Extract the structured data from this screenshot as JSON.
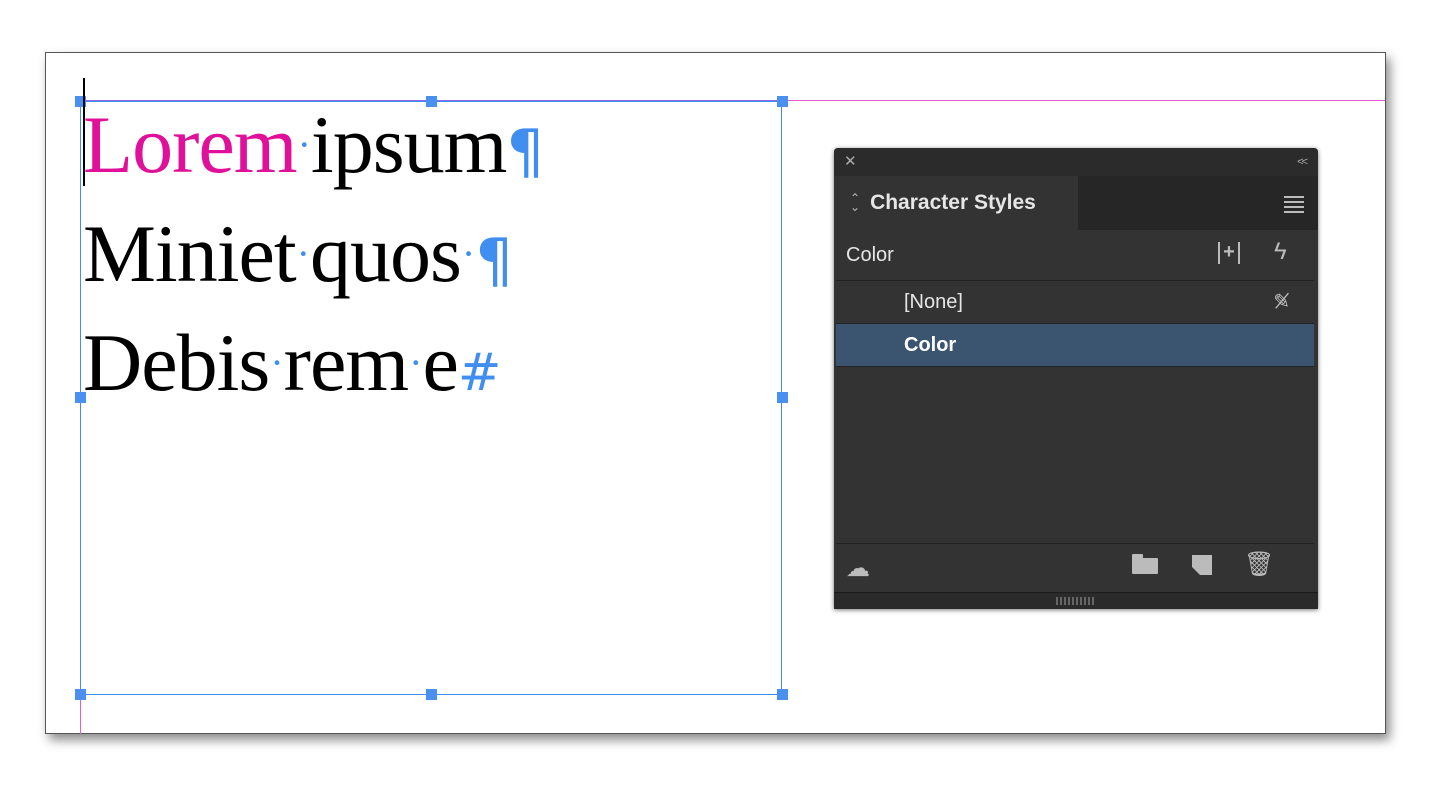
{
  "document": {
    "lines": [
      {
        "words": [
          "Lorem",
          "ipsum"
        ],
        "end_mark": "¶"
      },
      {
        "words": [
          "Miniet",
          "quos"
        ],
        "end_mark": "¶"
      },
      {
        "words": [
          "Debis",
          "rem",
          "e"
        ],
        "end_mark": "#"
      }
    ],
    "space_marker": "·",
    "accent_color": "#e0109a",
    "frame_color": "#3f8ef0"
  },
  "panel": {
    "title": "Character Styles",
    "current_style": "Color",
    "styles": [
      {
        "label": "[None]",
        "selected": false
      },
      {
        "label": "Color",
        "selected": true
      }
    ],
    "icons": {
      "close": "close-icon",
      "collapse": "collapse-icon",
      "menu": "panel-menu-icon",
      "new_group": "new-group-icon",
      "quick_apply": "lightning-icon",
      "no_edit": "pencil-slash-icon",
      "cc_library": "cloud-icon",
      "folder": "folder-icon",
      "new_style": "new-style-icon",
      "delete": "trash-icon"
    },
    "selection_color": "#3b5570"
  }
}
